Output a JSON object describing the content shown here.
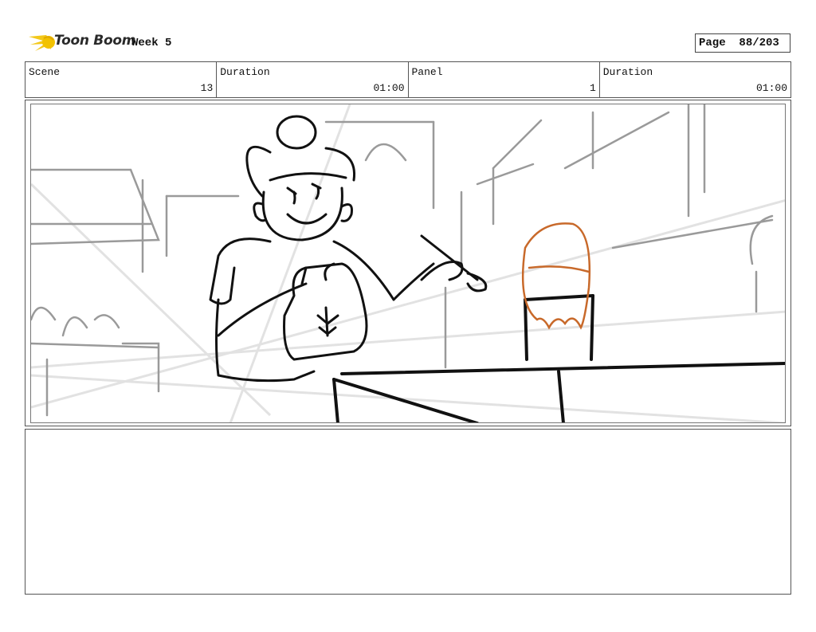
{
  "header": {
    "logo_text": "Toon Boom",
    "title": "Week 5",
    "page_label": "Page",
    "page_value": "88/203"
  },
  "info": {
    "scene": {
      "label": "Scene",
      "value": "13"
    },
    "scene_duration": {
      "label": "Duration",
      "value": "01:00"
    },
    "panel": {
      "label": "Panel",
      "value": "1"
    },
    "panel_duration": {
      "label": "Duration",
      "value": "01:00"
    }
  },
  "colors": {
    "accent_sketch": "#c8692a",
    "logo_star": "#f2c200"
  }
}
